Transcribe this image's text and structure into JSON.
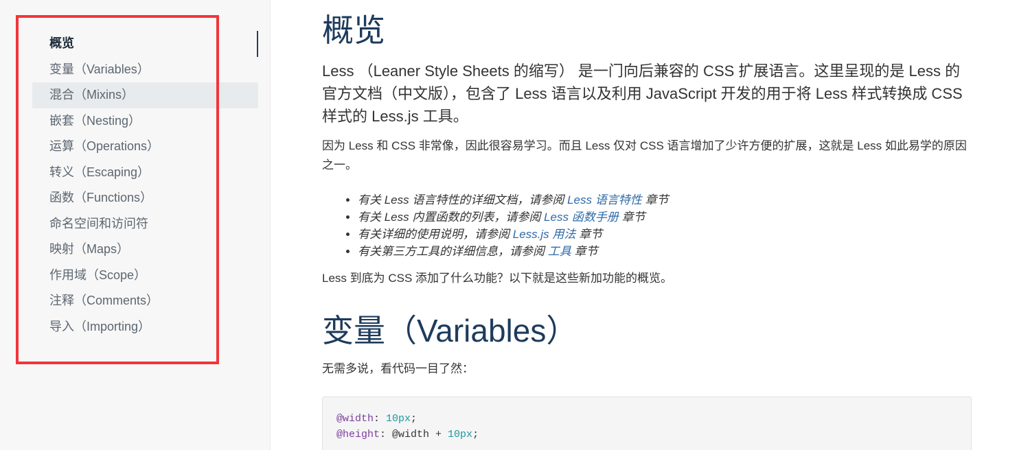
{
  "sidebar": {
    "items": [
      {
        "label": "概览"
      },
      {
        "label": "变量（Variables）"
      },
      {
        "label": "混合（Mixins）"
      },
      {
        "label": "嵌套（Nesting）"
      },
      {
        "label": "运算（Operations）"
      },
      {
        "label": "转义（Escaping）"
      },
      {
        "label": "函数（Functions）"
      },
      {
        "label": "命名空间和访问符"
      },
      {
        "label": "映射（Maps）"
      },
      {
        "label": "作用域（Scope）"
      },
      {
        "label": "注释（Comments）"
      },
      {
        "label": "导入（Importing）"
      }
    ],
    "current_index": 0,
    "hover_index": 2
  },
  "main": {
    "title": "概览",
    "lead": "Less （Leaner Style Sheets 的缩写） 是一门向后兼容的 CSS 扩展语言。这里呈现的是 Less 的官方文档（中文版），包含了 Less 语言以及利用 JavaScript 开发的用于将 Less 样式转换成 CSS 样式的 Less.js 工具。",
    "para1": "因为 Less 和 CSS 非常像，因此很容易学习。而且 Less 仅对 CSS 语言增加了少许方便的扩展，这就是 Less 如此易学的原因之一。",
    "bullets": [
      {
        "pre": "有关 Less 语言特性的详细文档，请参阅 ",
        "link": "Less 语言特性",
        "post": " 章节"
      },
      {
        "pre": "有关 Less 内置函数的列表，请参阅 ",
        "link": "Less 函数手册",
        "post": " 章节"
      },
      {
        "pre": "有关详细的使用说明，请参阅 ",
        "link": "Less.js 用法",
        "post": " 章节"
      },
      {
        "pre": "有关第三方工具的详细信息，请参阅 ",
        "link": "工具",
        "post": " 章节"
      }
    ],
    "para2": "Less 到底为 CSS 添加了什么功能？以下就是这些新加功能的概览。",
    "section_title": "变量（Variables）",
    "section_intro": "无需多说，看代码一目了然：",
    "code": {
      "line1": {
        "var": "@width",
        "rest": ": ",
        "num": "10px",
        "end": ";"
      },
      "line2": {
        "var": "@height",
        "rest": ": @width + ",
        "num": "10px",
        "end": ";"
      }
    }
  },
  "colors": {
    "highlight_box": "#f2353a",
    "heading": "#1d3b5c",
    "link": "#2f6aa8",
    "sidebar_bg": "#f7f7f7",
    "hover_bg": "#e8ebee"
  }
}
